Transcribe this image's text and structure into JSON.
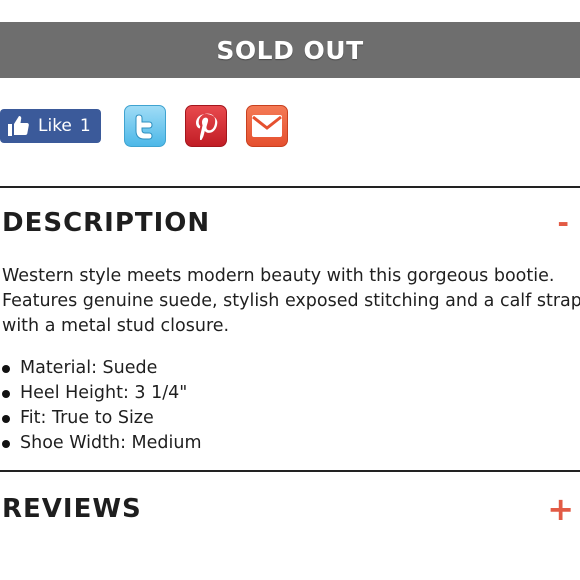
{
  "status": {
    "label": "SOLD OUT"
  },
  "share": {
    "facebook": {
      "label": "Like",
      "count": "1"
    },
    "icons": [
      "twitter-icon",
      "pinterest-icon",
      "email-icon"
    ]
  },
  "description": {
    "title": "DESCRIPTION",
    "toggle": "-",
    "text": "Western style meets modern beauty with this gorgeous bootie. Features genuine suede, stylish exposed stitching and a calf strap with a metal stud closure.",
    "bullets": [
      "Material: Suede",
      "Heel Height: 3 1/4\"",
      "Fit: True to Size",
      "Shoe Width: Medium"
    ]
  },
  "reviews": {
    "title": "REVIEWS",
    "toggle": "+"
  },
  "colors": {
    "soldout_bg": "#6e6e6e",
    "accent": "#e25b45",
    "facebook": "#3b5a9a"
  }
}
